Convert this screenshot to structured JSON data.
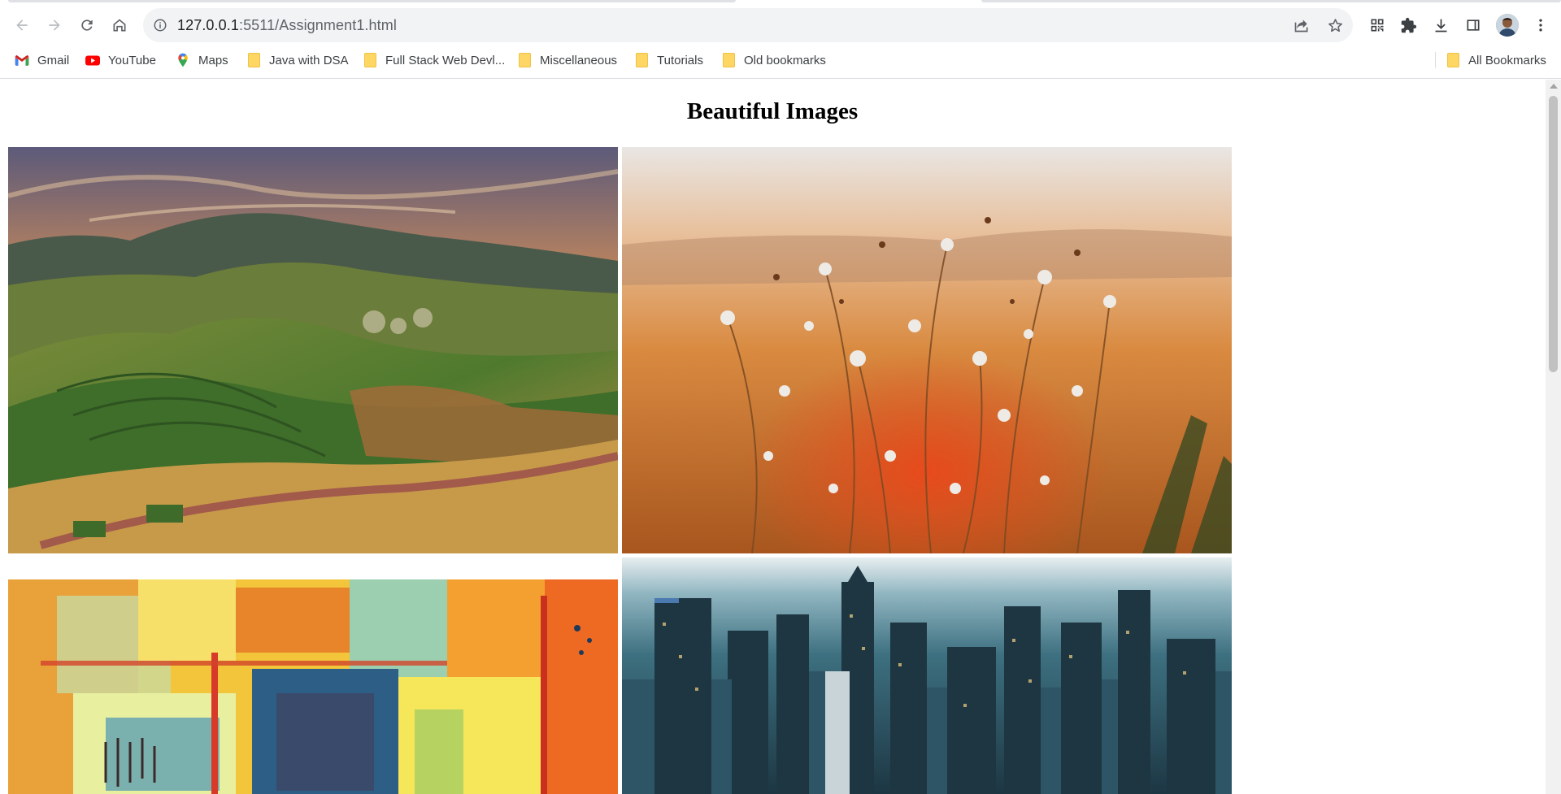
{
  "browser": {
    "url_host": "127.0.0.1",
    "url_path": ":5511/Assignment1.html",
    "icons": {
      "back": "arrow-left-icon",
      "forward": "arrow-right-icon",
      "reload": "reload-icon",
      "home": "home-icon",
      "site_info": "info-icon",
      "share": "share-icon",
      "bookmark": "star-icon",
      "qr": "qr-code-icon",
      "extensions": "puzzle-icon",
      "download": "download-icon",
      "side_panel": "side-panel-icon",
      "menu": "kebab-menu-icon"
    }
  },
  "bookmarks": {
    "items": [
      {
        "label": "Gmail",
        "icon": "gmail-icon"
      },
      {
        "label": "YouTube",
        "icon": "youtube-icon"
      },
      {
        "label": "Maps",
        "icon": "maps-icon"
      },
      {
        "label": "Java with DSA",
        "icon": "folder-icon"
      },
      {
        "label": "Full Stack Web Devl...",
        "icon": "folder-icon"
      },
      {
        "label": "Miscellaneous",
        "icon": "folder-icon"
      },
      {
        "label": "Tutorials",
        "icon": "folder-icon"
      },
      {
        "label": "Old bookmarks",
        "icon": "folder-icon"
      }
    ],
    "all_bookmarks": "All Bookmarks"
  },
  "page": {
    "heading": "Beautiful Images",
    "images": [
      {
        "subject": "rolling hills vineyard landscape at sunset"
      },
      {
        "subject": "wildflowers in golden sunset light"
      },
      {
        "subject": "colorful abstract painting"
      },
      {
        "subject": "aerial city skyline"
      }
    ]
  },
  "colors": {
    "chrome_bg": "#ffffff",
    "omnibox_bg": "#f1f3f4",
    "folder": "#fdd663"
  }
}
